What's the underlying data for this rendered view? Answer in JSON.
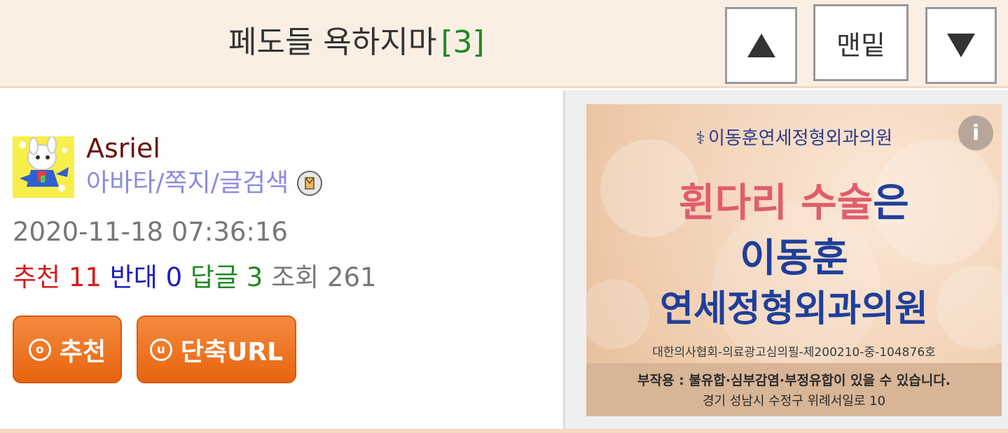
{
  "header": {
    "title": "페도들 욕하지마",
    "reply_count": "[3]",
    "up_icon": "triangle-up-icon",
    "bottom_label": "맨밑",
    "down_icon": "triangle-down-icon"
  },
  "post": {
    "username": "Asriel",
    "links": "아바타/쪽지/글검색",
    "datetime": "2020-11-18 07:36:16",
    "stats": {
      "recommend_label": "추천",
      "recommend_value": "11",
      "oppose_label": "반대",
      "oppose_value": "0",
      "reply_label": "답글",
      "reply_value": "3",
      "view_label": "조회",
      "view_value": "261"
    },
    "buttons": {
      "recommend_label": "추천",
      "recommend_icon_glyph": "o",
      "short_url_label": "단축URL",
      "short_url_icon_glyph": "u"
    }
  },
  "ad": {
    "brand": "이동훈연세정형외과의원",
    "info_glyph": "i",
    "line1_red": "휜다리 수술",
    "line1_blue": "은",
    "line2": "이동훈",
    "line3": "연세정형외과의원",
    "cert": "대한의사협회-의료광고심의필-제200210-중-104876호",
    "warning": "부작용 : 불유합·심부감염·부정유합이 있을 수 있습니다.",
    "address": "경기 성남시 수정구 위례서일로 10"
  }
}
